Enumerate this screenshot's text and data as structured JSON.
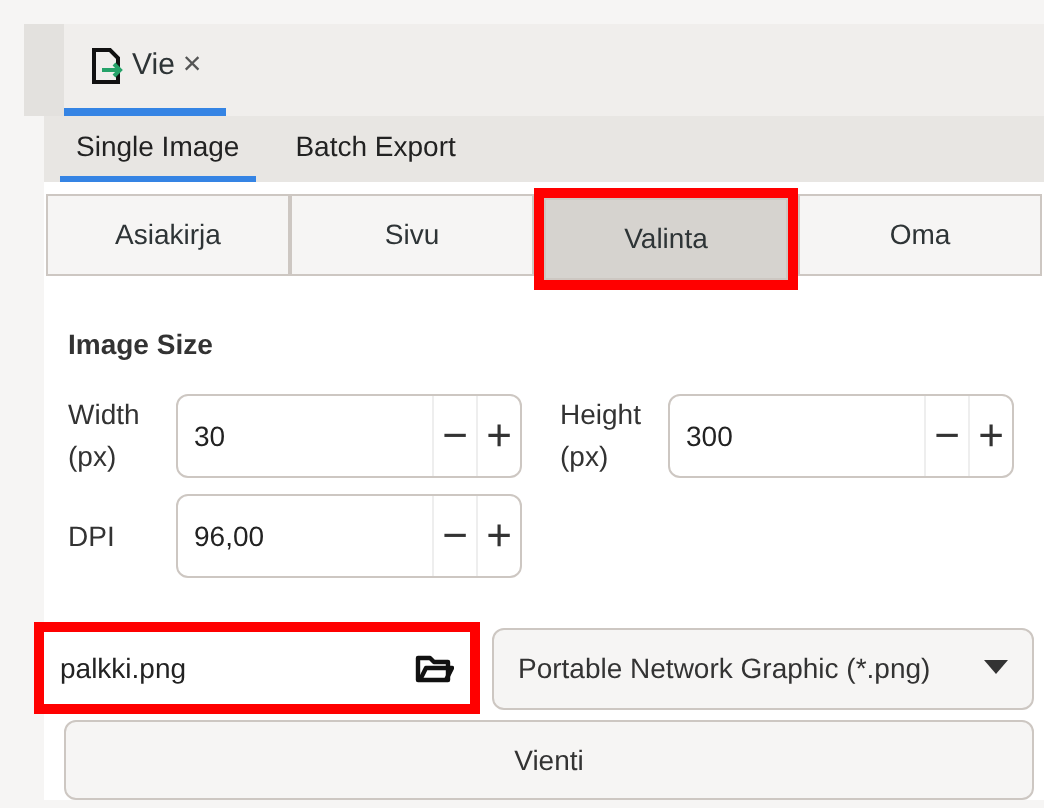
{
  "doc_tab": {
    "label": "Vie",
    "close": "×",
    "selected": true
  },
  "tabs": [
    {
      "label": "Single Image",
      "selected": true
    },
    {
      "label": "Batch Export",
      "selected": false
    }
  ],
  "areas": [
    {
      "label": "Asiakirja",
      "selected": false,
      "highlighted": false
    },
    {
      "label": "Sivu",
      "selected": false,
      "highlighted": false
    },
    {
      "label": "Valinta",
      "selected": true,
      "highlighted": true
    },
    {
      "label": "Oma",
      "selected": false,
      "highlighted": false
    }
  ],
  "image_size": {
    "title": "Image Size",
    "fields": [
      {
        "label": "Width\n(px)",
        "value": "30"
      },
      {
        "label": "Height\n(px)",
        "value": "300"
      },
      {
        "label": "DPI",
        "value": "96,00"
      }
    ],
    "minus": "−",
    "plus": "+"
  },
  "filename": {
    "value": "palkki.png",
    "highlighted": true
  },
  "format": {
    "value": "Portable Network Graphic (*.png)"
  },
  "export_button": "Vienti"
}
